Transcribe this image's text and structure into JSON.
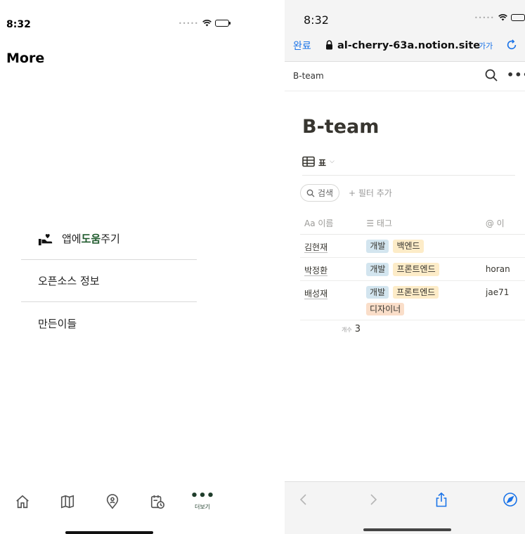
{
  "left_screen": {
    "status_time": "8:32",
    "title": "More",
    "menu": {
      "help_prefix": "앱에 ",
      "help_highlight": "도움",
      "help_suffix": "주기",
      "opensource": "오픈소스 정보",
      "makers": "만든이들"
    },
    "tabbar": {
      "more_dots": "•••",
      "more_label": "더보기"
    }
  },
  "right_screen": {
    "status_time": "8:32",
    "done_label": "완료",
    "url": "al-cherry-63a.notion.site",
    "text_size_label": "가가",
    "breadcrumb": "B-team",
    "ellipsis": "•••",
    "page_title": "B-team",
    "view": {
      "name": "표",
      "chevron": "⌵"
    },
    "search_label": "검색",
    "filter_add": "+ 필터 추가",
    "columns": {
      "name": "Aa 이름",
      "tags": "☰ 태그",
      "email": "@ 이"
    },
    "rows": [
      {
        "name": "김현재",
        "tags": [
          {
            "label": "개발",
            "color": "blue"
          },
          {
            "label": "백엔드",
            "color": "yellow"
          }
        ],
        "email": ""
      },
      {
        "name": "박정환",
        "tags": [
          {
            "label": "개발",
            "color": "blue"
          },
          {
            "label": "프론트엔드",
            "color": "yellow"
          }
        ],
        "email": "horan"
      },
      {
        "name": "배성재",
        "tags": [
          {
            "label": "개발",
            "color": "blue"
          },
          {
            "label": "프론트엔드",
            "color": "yellow"
          },
          {
            "label": "디자이너",
            "color": "orange"
          }
        ],
        "email": "jae71"
      }
    ],
    "count_label": "개수",
    "count_value": "3"
  },
  "colors": {
    "highlight_green": "#1f5a2c",
    "safari_blue": "#1a73e8",
    "tag_blue": "#d3e5ef",
    "tag_yellow": "#fdecc8",
    "tag_orange": "#fadec9"
  },
  "icons": [
    "heart-hand-icon",
    "home-icon",
    "map-icon",
    "location-pin-icon",
    "calendar-clock-icon",
    "lock-icon",
    "reload-icon",
    "search-icon",
    "table-icon",
    "back-icon",
    "forward-icon",
    "share-icon",
    "compass-icon"
  ]
}
